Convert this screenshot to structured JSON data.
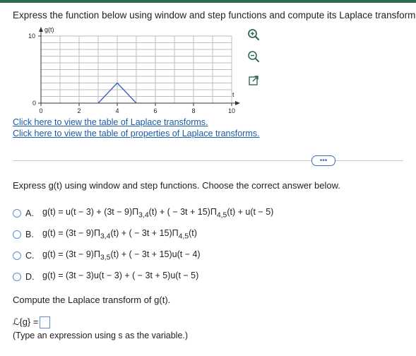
{
  "question": {
    "title": "Express the function below using window and step functions and compute its Laplace transform."
  },
  "graph": {
    "ylabel": "g(t)",
    "xlabel": "t",
    "y_ticks": [
      "10",
      "0"
    ],
    "x_ticks": [
      "0",
      "2",
      "4",
      "6",
      "8",
      "10"
    ],
    "xlim": [
      0,
      10
    ],
    "ylim": [
      0,
      10
    ],
    "line_points": [
      [
        3,
        0
      ],
      [
        4,
        3
      ],
      [
        5,
        0
      ]
    ],
    "line_color": "#3a5fbf",
    "grid": true
  },
  "tools": {
    "zoom_in": "zoom-in-icon",
    "zoom_out": "zoom-out-icon",
    "popout": "popout-icon"
  },
  "links": {
    "laplace_table": "Click here to view the table of Laplace transforms.",
    "laplace_properties": "Click here to view the table of properties of Laplace transforms."
  },
  "more_button": "•••",
  "prompt": "Express g(t) using window and step functions. Choose the correct answer below.",
  "choices": [
    {
      "letter": "A.",
      "text": "g(t) = u(t − 3) + (3t − 9)Π",
      "sub1": "3,4",
      "text2": "(t) + ( − 3t + 15)Π",
      "sub2": "4,5",
      "text3": "(t) + u(t − 5)"
    },
    {
      "letter": "B.",
      "text": "g(t) = (3t − 9)Π",
      "sub1": "3,4",
      "text2": "(t) + ( − 3t + 15)Π",
      "sub2": "4,5",
      "text3": "(t)"
    },
    {
      "letter": "C.",
      "text": "g(t) = (3t − 9)Π",
      "sub1": "3,5",
      "text2": "(t) + ( − 3t + 15)u(t − 4)",
      "sub2": "",
      "text3": ""
    },
    {
      "letter": "D.",
      "text": "g(t) = (3t − 3)u(t − 3) + ( − 3t + 5)u(t − 5)",
      "sub1": "",
      "text2": "",
      "sub2": "",
      "text3": ""
    }
  ],
  "compute_prompt": "Compute the Laplace transform of g(t).",
  "answer_label": "ℒ{g} =",
  "hint": "(Type an expression using s as the variable.)"
}
